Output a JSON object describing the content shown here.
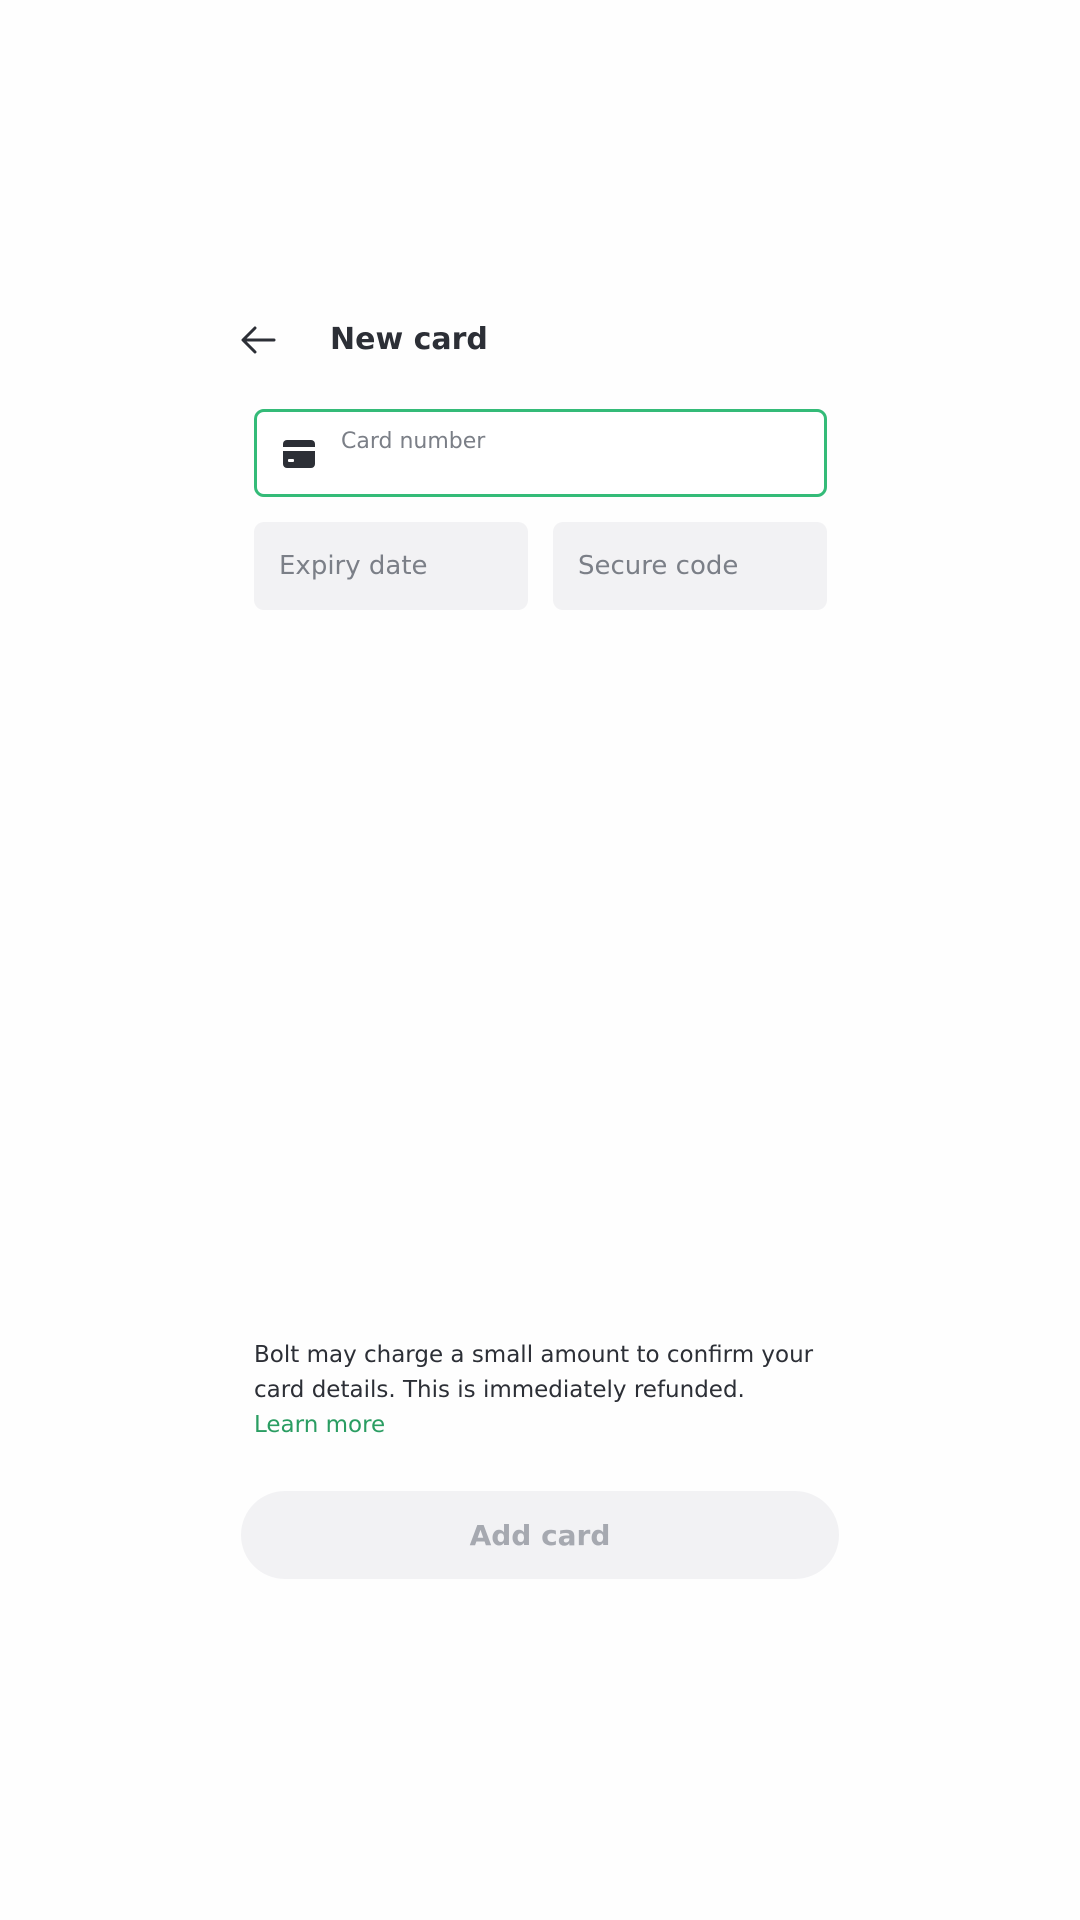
{
  "header": {
    "title": "New card",
    "back_icon": "arrow-left-icon"
  },
  "form": {
    "card_number": {
      "placeholder": "Card number",
      "value": "",
      "icon": "credit-card-icon"
    },
    "expiry_date": {
      "placeholder": "Expiry date",
      "value": ""
    },
    "secure_code": {
      "placeholder": "Secure code",
      "value": ""
    }
  },
  "info": {
    "text": "Bolt may charge a small amount to confirm your card details. This is immediately refunded.",
    "link_label": "Learn more"
  },
  "actions": {
    "add_card_label": "Add card"
  },
  "colors": {
    "accent": "#34bb78",
    "link": "#2a9d62",
    "text": "#2c2f36",
    "field_bg": "#f2f2f4",
    "disabled_text": "#a6a9b0"
  }
}
